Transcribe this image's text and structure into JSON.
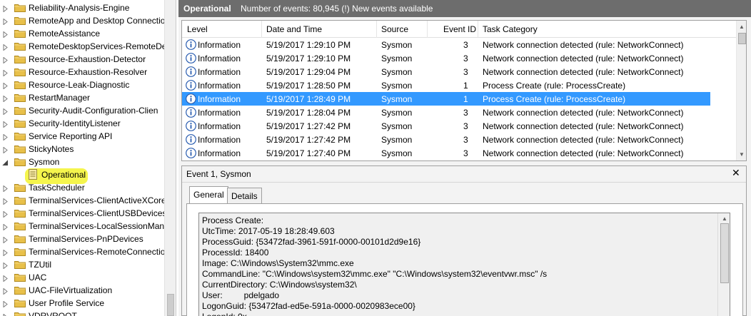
{
  "tree": {
    "items": [
      {
        "label": "Reliability-Analysis-Engine",
        "expanded": false
      },
      {
        "label": "RemoteApp and Desktop Connectio",
        "expanded": false
      },
      {
        "label": "RemoteAssistance",
        "expanded": false
      },
      {
        "label": "RemoteDesktopServices-RemoteDes",
        "expanded": false
      },
      {
        "label": "Resource-Exhaustion-Detector",
        "expanded": false
      },
      {
        "label": "Resource-Exhaustion-Resolver",
        "expanded": false
      },
      {
        "label": "Resource-Leak-Diagnostic",
        "expanded": false
      },
      {
        "label": "RestartManager",
        "expanded": false
      },
      {
        "label": "Security-Audit-Configuration-Clien",
        "expanded": false
      },
      {
        "label": "Security-IdentityListener",
        "expanded": false
      },
      {
        "label": "Service Reporting API",
        "expanded": false
      },
      {
        "label": "StickyNotes",
        "expanded": false
      },
      {
        "label": "Sysmon",
        "expanded": true
      },
      {
        "label": "Operational",
        "child": true,
        "selected": true
      },
      {
        "label": "TaskScheduler",
        "expanded": false
      },
      {
        "label": "TerminalServices-ClientActiveXCore",
        "expanded": false
      },
      {
        "label": "TerminalServices-ClientUSBDevices",
        "expanded": false
      },
      {
        "label": "TerminalServices-LocalSessionMana",
        "expanded": false
      },
      {
        "label": "TerminalServices-PnPDevices",
        "expanded": false
      },
      {
        "label": "TerminalServices-RemoteConnectio",
        "expanded": false
      },
      {
        "label": "TZUtil",
        "expanded": false
      },
      {
        "label": "UAC",
        "expanded": false
      },
      {
        "label": "UAC-FileVirtualization",
        "expanded": false
      },
      {
        "label": "User Profile Service",
        "expanded": false
      },
      {
        "label": "VDRVROOT",
        "expanded": false
      }
    ]
  },
  "header": {
    "title": "Operational",
    "info": "Number of events: 80,945 (!) New events available"
  },
  "grid": {
    "columns": [
      "Level",
      "Date and Time",
      "Source",
      "Event ID",
      "Task Category"
    ],
    "rows": [
      {
        "level": "Information",
        "datetime": "5/19/2017 1:29:10 PM",
        "source": "Sysmon",
        "event_id": "3",
        "category": "Network connection detected (rule: NetworkConnect)",
        "selected": false
      },
      {
        "level": "Information",
        "datetime": "5/19/2017 1:29:10 PM",
        "source": "Sysmon",
        "event_id": "3",
        "category": "Network connection detected (rule: NetworkConnect)",
        "selected": false
      },
      {
        "level": "Information",
        "datetime": "5/19/2017 1:29:04 PM",
        "source": "Sysmon",
        "event_id": "3",
        "category": "Network connection detected (rule: NetworkConnect)",
        "selected": false
      },
      {
        "level": "Information",
        "datetime": "5/19/2017 1:28:50 PM",
        "source": "Sysmon",
        "event_id": "1",
        "category": "Process Create (rule: ProcessCreate)",
        "selected": false
      },
      {
        "level": "Information",
        "datetime": "5/19/2017 1:28:49 PM",
        "source": "Sysmon",
        "event_id": "1",
        "category": "Process Create (rule: ProcessCreate)",
        "selected": true
      },
      {
        "level": "Information",
        "datetime": "5/19/2017 1:28:04 PM",
        "source": "Sysmon",
        "event_id": "3",
        "category": "Network connection detected (rule: NetworkConnect)",
        "selected": false
      },
      {
        "level": "Information",
        "datetime": "5/19/2017 1:27:42 PM",
        "source": "Sysmon",
        "event_id": "3",
        "category": "Network connection detected (rule: NetworkConnect)",
        "selected": false
      },
      {
        "level": "Information",
        "datetime": "5/19/2017 1:27:42 PM",
        "source": "Sysmon",
        "event_id": "3",
        "category": "Network connection detected (rule: NetworkConnect)",
        "selected": false
      },
      {
        "level": "Information",
        "datetime": "5/19/2017 1:27:40 PM",
        "source": "Sysmon",
        "event_id": "3",
        "category": "Network connection detected (rule: NetworkConnect)",
        "selected": false
      }
    ]
  },
  "details": {
    "title": "Event 1, Sysmon",
    "close_glyph": "✕",
    "tabs": [
      {
        "label": "General",
        "active": true
      },
      {
        "label": "Details",
        "active": false
      }
    ],
    "lines": [
      "Process Create:",
      "UtcTime: 2017-05-19 18:28:49.603",
      "ProcessGuid: {53472fad-3961-591f-0000-00101d2d9e16}",
      "ProcessId: 18400",
      "Image: C:\\Windows\\System32\\mmc.exe",
      "CommandLine: \"C:\\Windows\\system32\\mmc.exe\" \"C:\\Windows\\system32\\eventvwr.msc\" /s",
      "CurrentDirectory: C:\\Windows\\system32\\",
      "User:         pdelgado",
      "LogonGuid: {53472fad-ed5e-591a-0000-0020983ece00}",
      "LogonId: 0x..."
    ]
  },
  "colors": {
    "header_bg": "#6d6d6d",
    "selection": "#3399ff",
    "highlight": "#f4f43a",
    "folder": "#e8c04a",
    "info_icon": "#2a5db0"
  },
  "icons": {
    "collapsed": "triangle-right-icon",
    "expanded": "triangle-down-icon",
    "folder": "folder-icon",
    "log": "event-log-icon",
    "info": "information-icon"
  }
}
